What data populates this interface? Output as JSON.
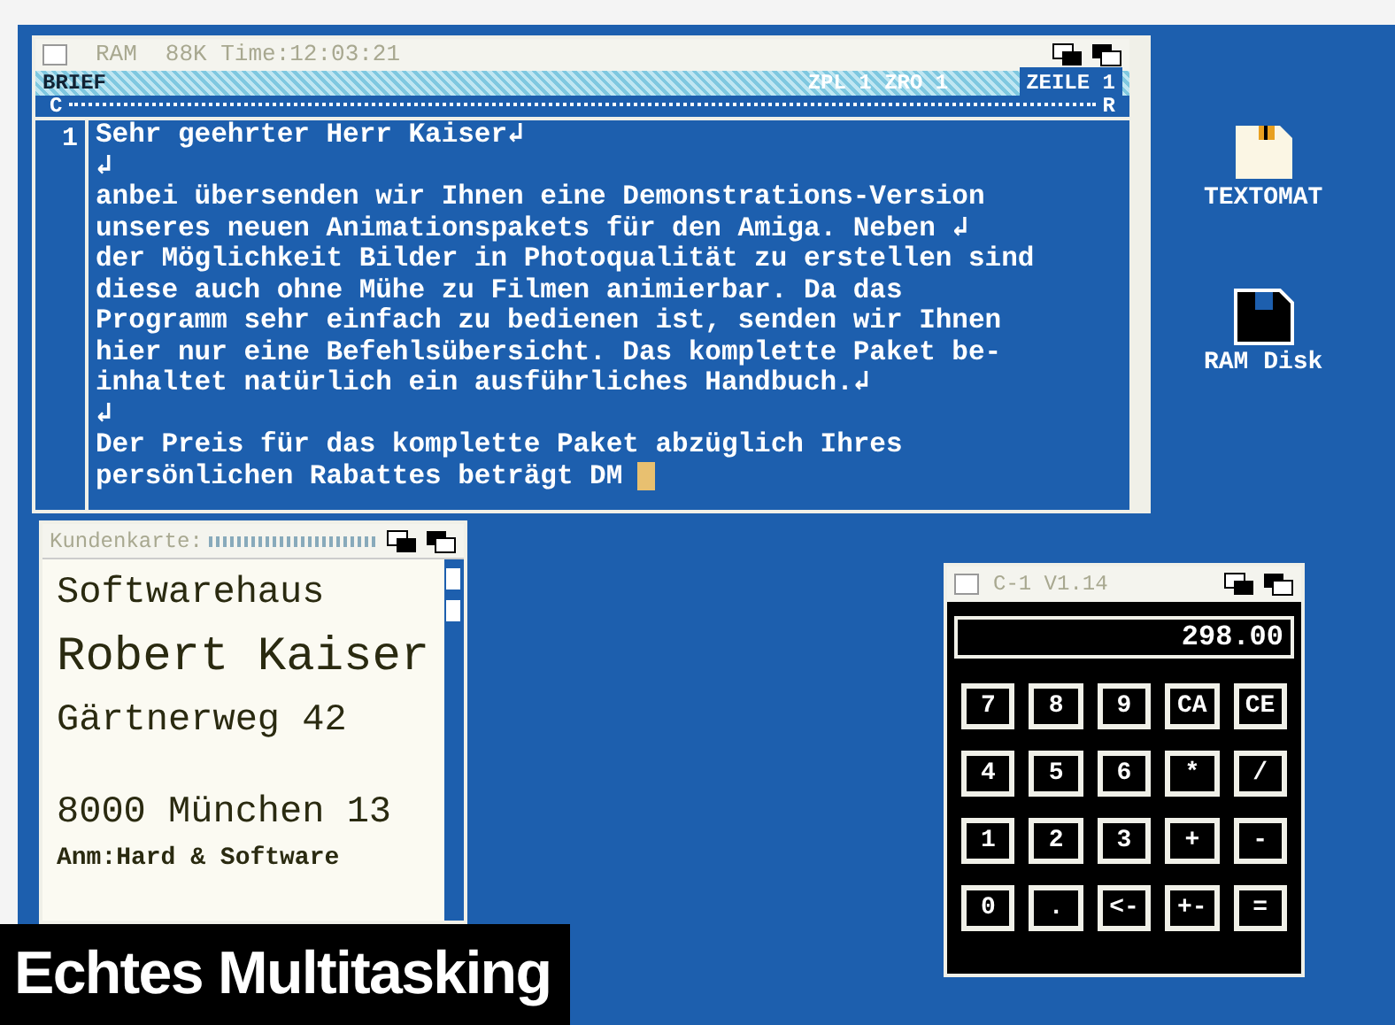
{
  "editor": {
    "title": "RAM",
    "info": "88K Time:12:03:21",
    "status_left": "BRIEF",
    "status_mid": "ZPL 1 ZRO 1",
    "status_right": "ZEILE 1",
    "ruler_left": "C",
    "ruler_right": "R",
    "line_number": "1",
    "cursor": true,
    "lines": [
      "Sehr geehrter Herr Kaiser↲",
      "↲",
      "anbei übersenden wir Ihnen eine Demonstrations-Version",
      "unseres neuen Animationspakets für den Amiga. Neben ↲",
      "der Möglichkeit Bilder in Photoqualität zu erstellen sind",
      "diese auch ohne Mühe zu Filmen animierbar. Da das",
      "Programm sehr einfach zu bedienen ist, senden wir Ihnen",
      "hier nur eine Befehlsübersicht. Das komplette Paket be-",
      "inhaltet natürlich ein ausführliches Handbuch.↲",
      "↲",
      "Der Preis für das komplette Paket abzüglich Ihres",
      "persönlichen Rabattes beträgt DM"
    ]
  },
  "desktop_icons": [
    {
      "label": "TEXTOMAT",
      "kind": "tool"
    },
    {
      "label": "RAM Disk",
      "kind": "disk"
    }
  ],
  "card_window": {
    "title": "Kundenkarte:",
    "lines": [
      {
        "text": "Softwarehaus",
        "kind": "normal"
      },
      {
        "text": "Robert Kaiser",
        "kind": "large"
      },
      {
        "text": "Gärtnerweg 42",
        "kind": "normal"
      },
      {
        "text": "8000 München 13",
        "kind": "normal",
        "gap": true
      },
      {
        "text": "Anm:Hard & Software",
        "kind": "small"
      }
    ]
  },
  "calculator": {
    "title": "C-1 V1.14",
    "display": "298.00",
    "keys": [
      "7",
      "8",
      "9",
      "CA",
      "CE",
      "4",
      "5",
      "6",
      "*",
      "/",
      "1",
      "2",
      "3",
      "+",
      "-",
      "0",
      ".",
      "<-",
      "+-",
      "="
    ]
  },
  "caption": "Echtes Multitasking"
}
